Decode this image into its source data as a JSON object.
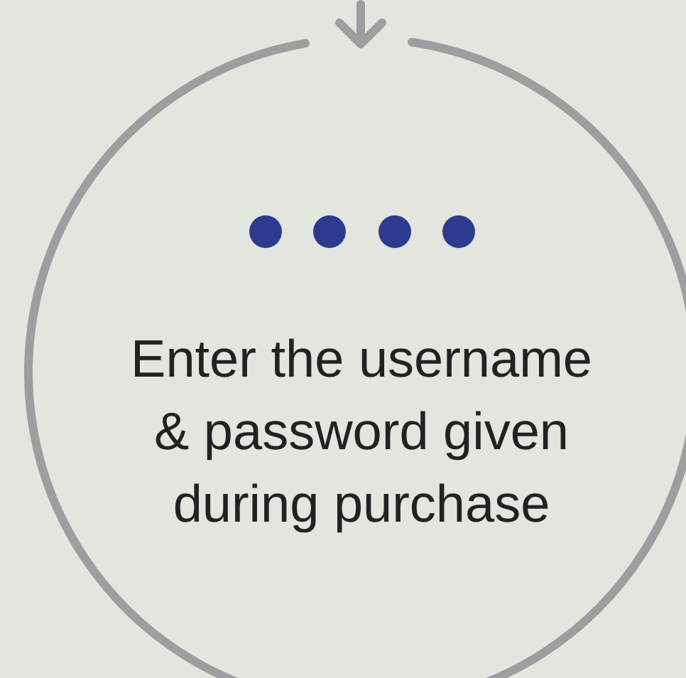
{
  "message": "Enter the username\n& password given\nduring purchase"
}
